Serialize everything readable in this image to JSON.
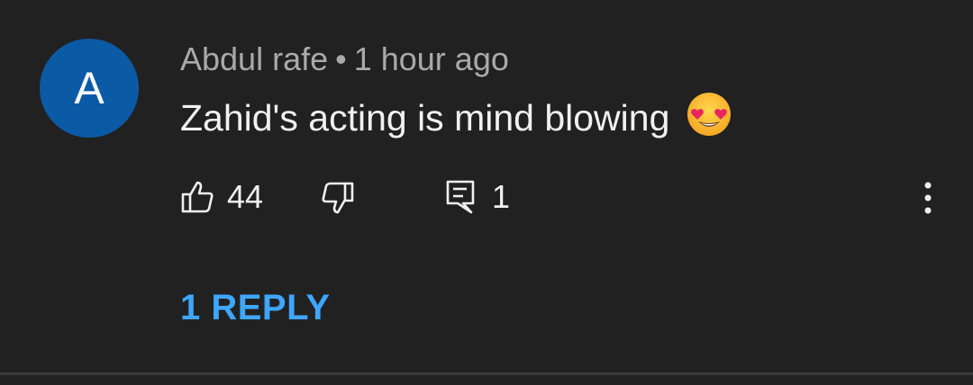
{
  "comment": {
    "avatar_letter": "A",
    "author": "Abdul rafe",
    "separator": "•",
    "time": "1 hour ago",
    "text": "Zahid's acting is mind blowing",
    "emoji_icon": "smiling-face-with-heart-eyes-icon",
    "likes": "44",
    "reply_count": "1",
    "replies_link": "1 REPLY"
  },
  "colors": {
    "background": "#212121",
    "avatar": "#0b5aa6",
    "link": "#3ea6ff",
    "meta_text": "#aaaaaa",
    "primary_text": "#f1f1f1"
  }
}
